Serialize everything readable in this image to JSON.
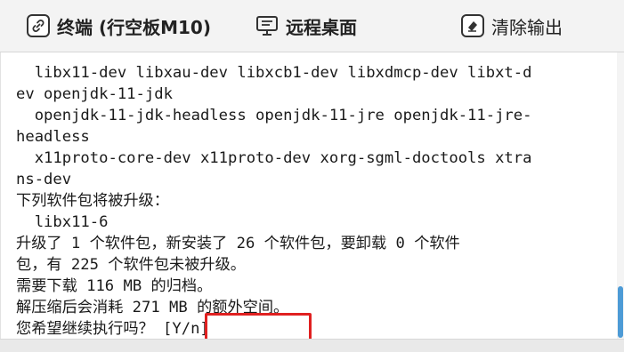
{
  "tabs": {
    "terminal_label": "终端 (行空板M10)",
    "terminal_icon": "link-icon",
    "remote_label": "远程桌面",
    "remote_icon": "monitor-icon",
    "clear_label": "清除输出",
    "clear_icon": "eraser-icon"
  },
  "terminal": {
    "lines": [
      "  libx11-dev libxau-dev libxcb1-dev libxdmcp-dev libxt-d",
      "ev openjdk-11-jdk",
      "  openjdk-11-jdk-headless openjdk-11-jre openjdk-11-jre-",
      "headless",
      "  x11proto-core-dev x11proto-dev xorg-sgml-doctools xtra",
      "ns-dev",
      "下列软件包将被升级：",
      "  libx11-6",
      "升级了 1 个软件包，新安装了 26 个软件包，要卸载 0 个软件",
      "包，有 225 个软件包未被升级。",
      "需要下载 116 MB 的归档。",
      "解压缩后会消耗 271 MB 的额外空间。",
      "您希望继续执行吗？ [Y/n]"
    ]
  },
  "colors": {
    "highlight": "#e02020",
    "scrollbar": "#4d9bd6"
  }
}
